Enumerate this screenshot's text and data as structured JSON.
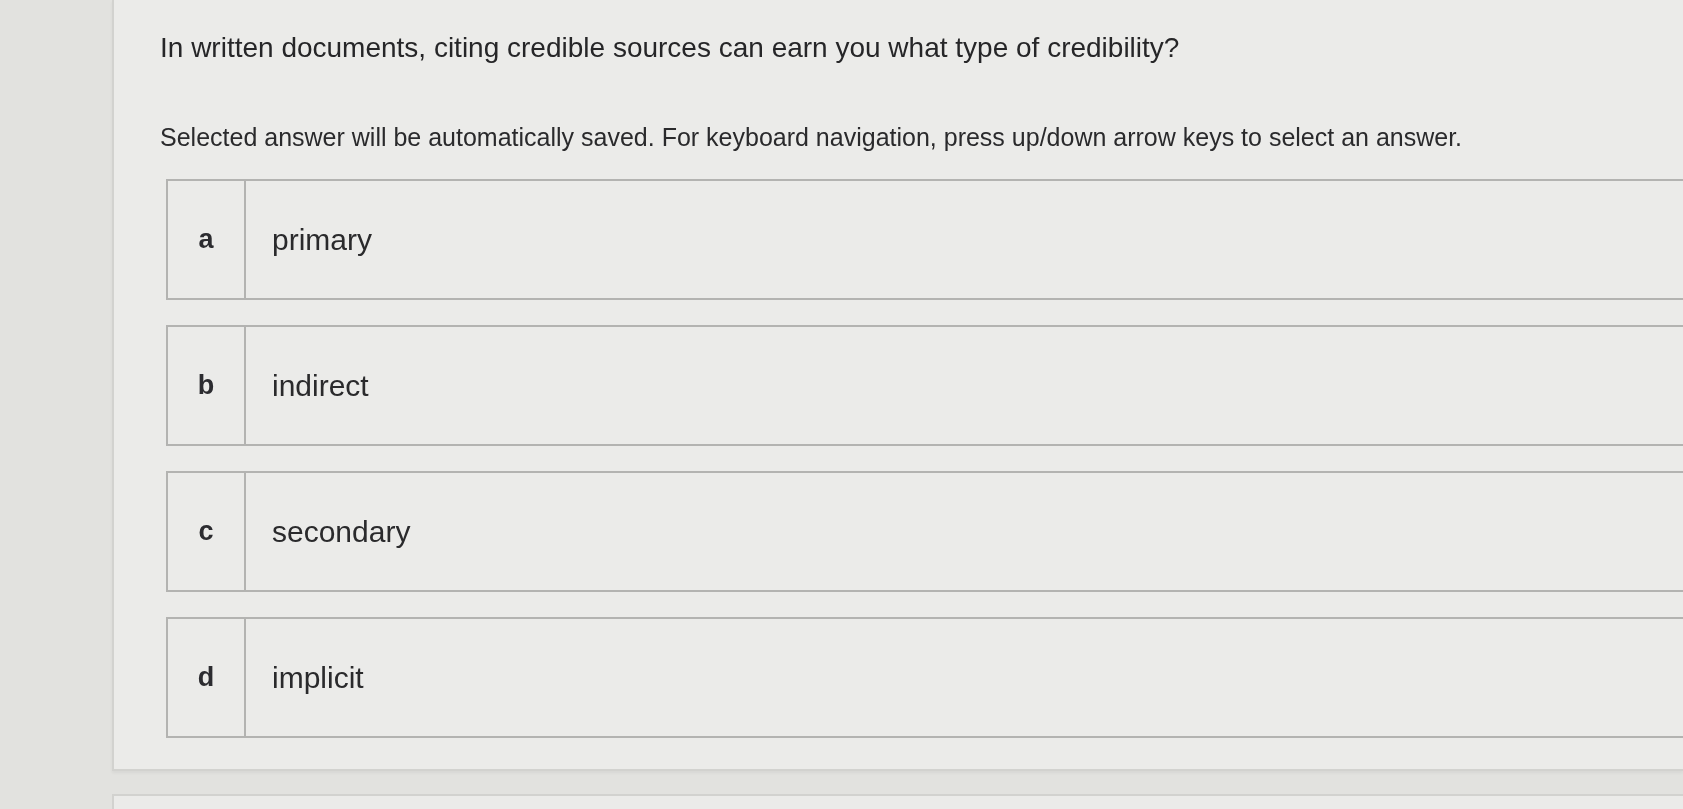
{
  "question": {
    "text": "In written documents, citing credible sources can earn you what type of credibility?",
    "instructions": "Selected answer will be automatically saved. For keyboard navigation, press up/down arrow keys to select an answer."
  },
  "options": [
    {
      "letter": "a",
      "text": "primary",
      "selected": false
    },
    {
      "letter": "b",
      "text": "indirect",
      "selected": false
    },
    {
      "letter": "c",
      "text": "secondary",
      "selected": false
    },
    {
      "letter": "d",
      "text": "implicit",
      "selected": false
    }
  ]
}
